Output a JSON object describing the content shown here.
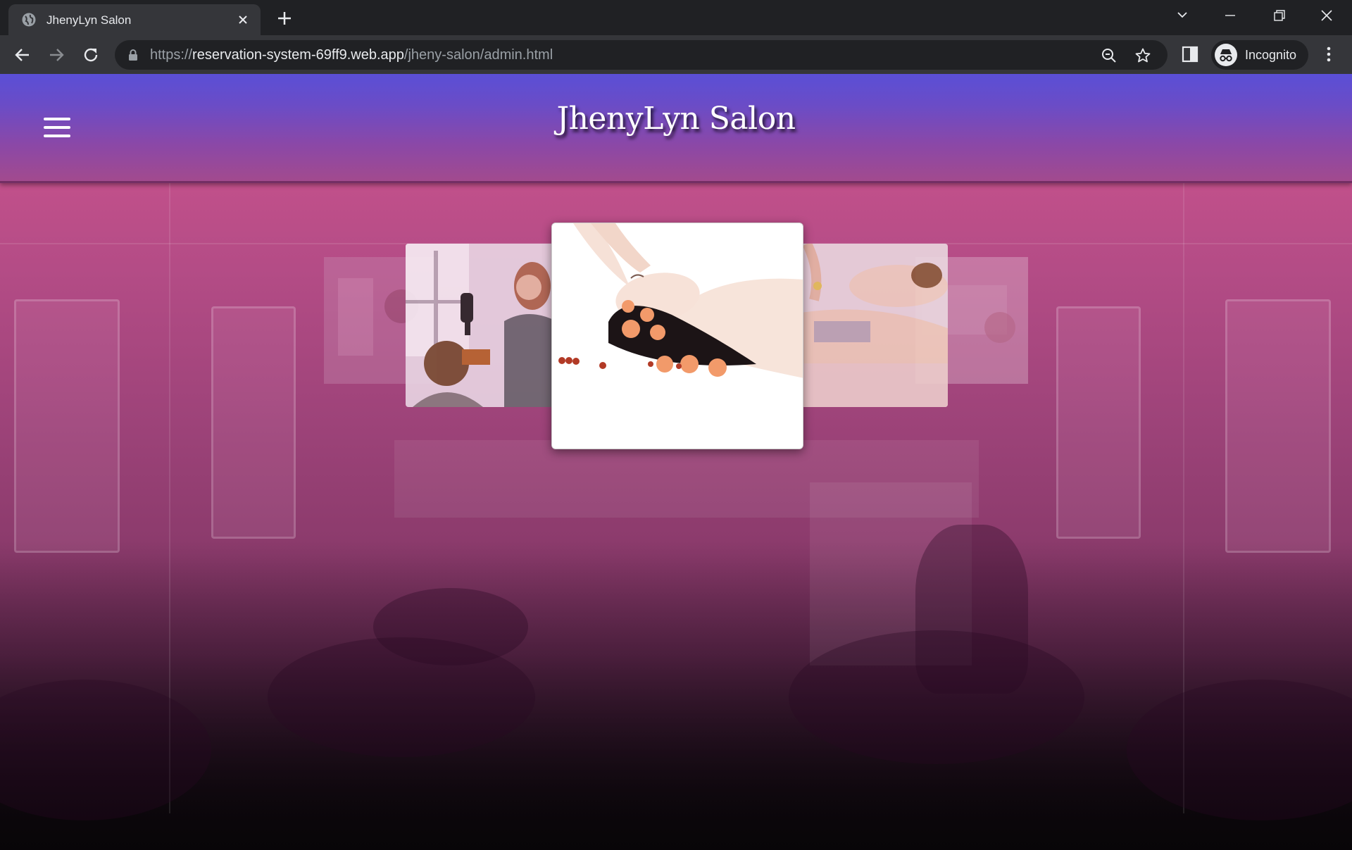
{
  "browser": {
    "tab": {
      "title": "JhenyLyn Salon",
      "favicon": "globe-icon",
      "close_icon": "close-icon"
    },
    "new_tab_icon": "plus-icon",
    "window_controls": [
      "tab-search-icon",
      "minimize-icon",
      "restore-icon",
      "close-icon"
    ],
    "url": {
      "scheme": "https://",
      "host": "reservation-system-69ff9.web.app",
      "path": "/jheny-salon/admin.html"
    },
    "omnibox_icons": [
      "zoom-icon",
      "star-icon"
    ],
    "profile": {
      "label": "Incognito",
      "icon": "incognito-icon"
    },
    "nav_icons": [
      "back-arrow-icon",
      "forward-arrow-icon",
      "reload-icon"
    ]
  },
  "site": {
    "title": "JhenyLyn Salon",
    "menu_icon": "hamburger-menu-icon",
    "colors": {
      "header_top": "#5a4fd6",
      "header_bottom": "#a24a8e",
      "page_tint": "#d15590"
    }
  },
  "carousel": {
    "slides": [
      {
        "name": "hair-blowdry-photo"
      },
      {
        "name": "spa-face-massage-with-flowers-photo"
      },
      {
        "name": "back-massage-oil-photo"
      }
    ],
    "active_index": 1
  }
}
